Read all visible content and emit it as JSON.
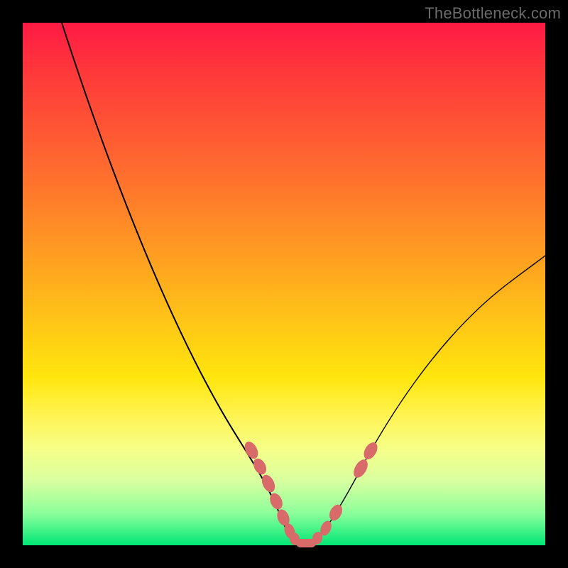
{
  "watermark": "TheBottleneck.com",
  "chart_data": {
    "type": "line",
    "title": "",
    "xlabel": "",
    "ylabel": "",
    "xlim": [
      0,
      100
    ],
    "ylim": [
      0,
      100
    ],
    "grid": false,
    "legend": false,
    "series": [
      {
        "name": "bottleneck-curve",
        "x": [
          5,
          10,
          15,
          20,
          25,
          30,
          35,
          40,
          44,
          46,
          48,
          50,
          52,
          54,
          56,
          60,
          64,
          68,
          72,
          76,
          82,
          90,
          100
        ],
        "y": [
          100,
          90,
          80,
          70,
          60,
          50,
          40,
          30,
          18,
          10,
          5,
          2,
          0,
          0,
          1,
          5,
          12,
          22,
          30,
          38,
          46,
          52,
          56
        ]
      }
    ],
    "markers": {
      "name": "highlighted-points",
      "color": "#d86a6a",
      "points": [
        {
          "x": 44,
          "y": 18
        },
        {
          "x": 45,
          "y": 14
        },
        {
          "x": 46.5,
          "y": 10
        },
        {
          "x": 48,
          "y": 6
        },
        {
          "x": 49,
          "y": 4
        },
        {
          "x": 50,
          "y": 2
        },
        {
          "x": 51,
          "y": 1
        },
        {
          "x": 55,
          "y": 1
        },
        {
          "x": 56,
          "y": 2
        },
        {
          "x": 58,
          "y": 4
        },
        {
          "x": 60,
          "y": 8
        },
        {
          "x": 64,
          "y": 16
        },
        {
          "x": 66,
          "y": 20
        }
      ],
      "bottom_bar": {
        "x_start": 51,
        "x_end": 55,
        "y": 0.5
      }
    },
    "background_gradient": {
      "direction": "vertical",
      "stops": [
        {
          "pos": 0.0,
          "color": "#ff1a44"
        },
        {
          "pos": 0.5,
          "color": "#ffb020"
        },
        {
          "pos": 0.75,
          "color": "#fff02a"
        },
        {
          "pos": 1.0,
          "color": "#00e676"
        }
      ]
    }
  }
}
